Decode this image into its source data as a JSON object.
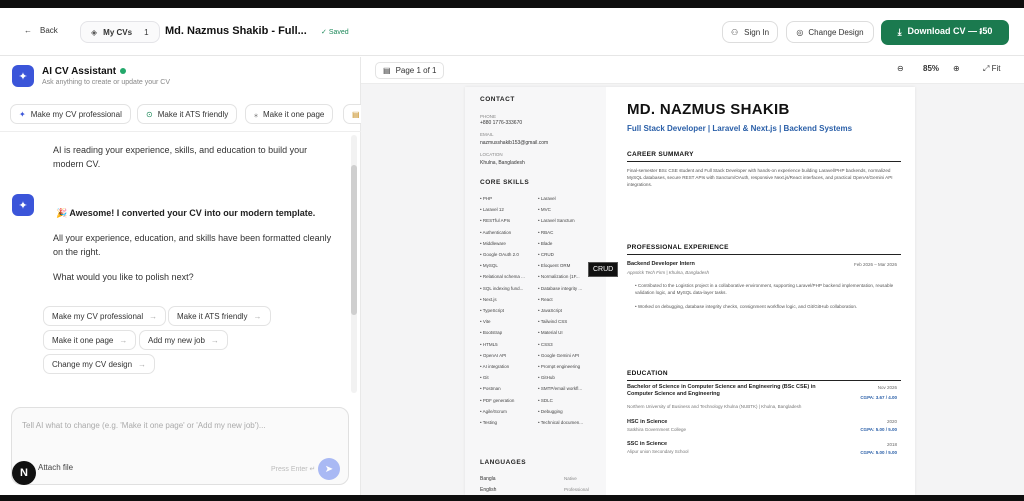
{
  "header": {
    "back_label": "Back",
    "mycvs_label": "My CVs",
    "mycvs_count": "1",
    "cv_title": "Md. Nazmus Shakib - Full...",
    "saved_label": "Saved",
    "signin_label": "Sign In",
    "change_design_label": "Change Design",
    "download_label": "Download CV — ៛50"
  },
  "assistant": {
    "title": "AI CV Assistant",
    "subtitle": "Ask anything to create or update your CV",
    "quick_actions": [
      "Make my CV professional",
      "Make it ATS friendly",
      "Make it one page"
    ],
    "messages": [
      {
        "text": "AI is reading your experience, skills, and education to build your modern CV."
      },
      {
        "heading": "🎉 Awesome! I converted your CV into our modern template.",
        "paragraphs": [
          "All your experience, education, and skills have been formatted cleanly on the right.",
          "What would you like to polish next?"
        ]
      }
    ],
    "suggestions": [
      "Make my CV professional",
      "Make it ATS friendly",
      "Make it one page",
      "Add my new job",
      "Change my CV design"
    ],
    "input_placeholder": "Tell AI what to change (e.g. 'Make it one page' or 'Add my new job')...",
    "attach_label": "Attach file",
    "press_enter": "Press Enter ↵",
    "n_badge": "N"
  },
  "preview": {
    "page_label": "Page 1 of 1",
    "zoom": "85%",
    "fit_label": "Fit",
    "tooltip": "CRUD"
  },
  "cv": {
    "contact_title": "CONTACT",
    "phone_label": "PHONE",
    "phone": "+880 1776-333670",
    "email_label": "EMAIL",
    "email": "nazmusshakib153@gmail.com",
    "location_label": "LOCATION",
    "location": "Khulna, Bangladesh",
    "skills_title": "CORE SKILLS",
    "skills_left": [
      "PHP",
      "Laravel 12",
      "RESTful APIs",
      "Authentication",
      "Middleware",
      "Google OAuth 2.0",
      "MySQL",
      "Relational schema ...",
      "SQL indexing fund...",
      "Next.js",
      "TypeScript",
      "Vite",
      "Bootstrap",
      "HTML5",
      "OpenAI API",
      "AI integration",
      "Git",
      "Postman",
      "PDF generation",
      "Agile/Scrum",
      "Testing"
    ],
    "skills_right": [
      "Laravel",
      "MVC",
      "Laravel Sanctum",
      "RBAC",
      "Blade",
      "CRUD",
      "Eloquent ORM",
      "Normalization (1F...",
      "Database integrity ...",
      "React",
      "JavaScript",
      "Tailwind CSS",
      "Material UI",
      "CSS3",
      "Google Gemini API",
      "Prompt engineering",
      "GitHub",
      "SMTP/email workfl...",
      "SDLC",
      "Debugging",
      "Technical documen..."
    ],
    "languages_title": "LANGUAGES",
    "languages": [
      {
        "name": "Bangla",
        "level": "Native"
      },
      {
        "name": "English",
        "level": "Professional"
      }
    ],
    "name": "MD. NAZMUS SHAKIB",
    "role": "Full Stack Developer | Laravel & Next.js | Backend Systems",
    "summary_title": "CAREER SUMMARY",
    "summary": "Final-semester BSc CSE student and Full Stack Developer with hands-on experience building Laravel/PHP backends, normalized MySQL databases, secure REST APIs with Sanctum/OAuth, responsive Next.js/React interfaces, and practical OpenAI/Gemini API integrations.",
    "experience_title": "PROFESSIONAL EXPERIENCE",
    "job_title": "Backend Developer Intern",
    "job_dates": "Feb 2026 – Mar 2026",
    "job_company": "Appstick Tech Firm | Khulna, Bangladesh",
    "job_bullets": [
      "Contributed to the Logistics project in a collaborative environment, supporting Laravel/PHP backend implementation, reusable validation logic, and MySQL data-layer tasks.",
      "Worked on debugging, database integrity checks, consignment workflow logic, and Git/GitHub collaboration."
    ],
    "education_title": "EDUCATION",
    "education": [
      {
        "degree": "Bachelor of Science in Computer Science and Engineering (BSc CSE) in Computer Science and Engineering",
        "school": "Northern University of Business and Technology Khulna (NUBTK) | Khulna, Bangladesh",
        "date": "Nov 2026",
        "gpa": "CGPA: 3.67 / 4.00"
      },
      {
        "degree": "HSC in Science",
        "school": "Satkhira Government College",
        "date": "2020",
        "gpa": "CGPA: 5.00 / 5.00"
      },
      {
        "degree": "SSC in Science",
        "school": "Alipur union Secondary School",
        "date": "2018",
        "gpa": "CGPA: 5.00 / 5.00"
      }
    ]
  }
}
